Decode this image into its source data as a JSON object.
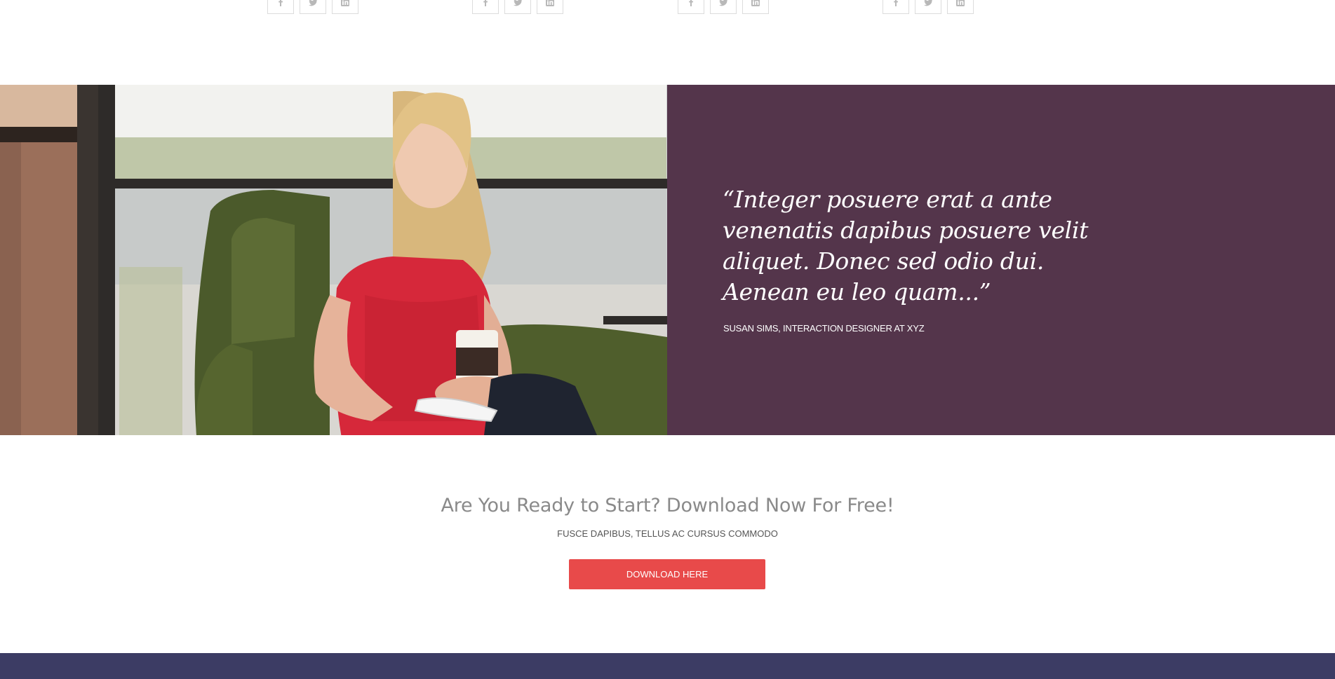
{
  "team_social": {
    "groups": [
      {
        "facebook": "f",
        "twitter": "twitter",
        "linkedin": "in"
      },
      {
        "facebook": "f",
        "twitter": "twitter",
        "linkedin": "in"
      },
      {
        "facebook": "f",
        "twitter": "twitter",
        "linkedin": "in"
      },
      {
        "facebook": "f",
        "twitter": "twitter",
        "linkedin": "in"
      }
    ],
    "icon_color": "#b8b8b8"
  },
  "testimonial": {
    "quote": "“Integer posuere erat a ante venenatis dapibus posuere velit aliquet. Donec sed odio dui. Aenean eu leo quam...”",
    "author": "SUSAN SIMS, INTERACTION DESIGNER AT XYZ",
    "panel_color": "#54354b"
  },
  "cta": {
    "title": "Are You Ready to Start? Download Now For Free!",
    "subtitle": "FUSCE DAPIBUS, TELLUS AC CURSUS COMMODO",
    "button_label": "DOWNLOAD HERE",
    "button_color": "#e84a4a"
  },
  "footer": {
    "band_color": "#3c3c64"
  }
}
